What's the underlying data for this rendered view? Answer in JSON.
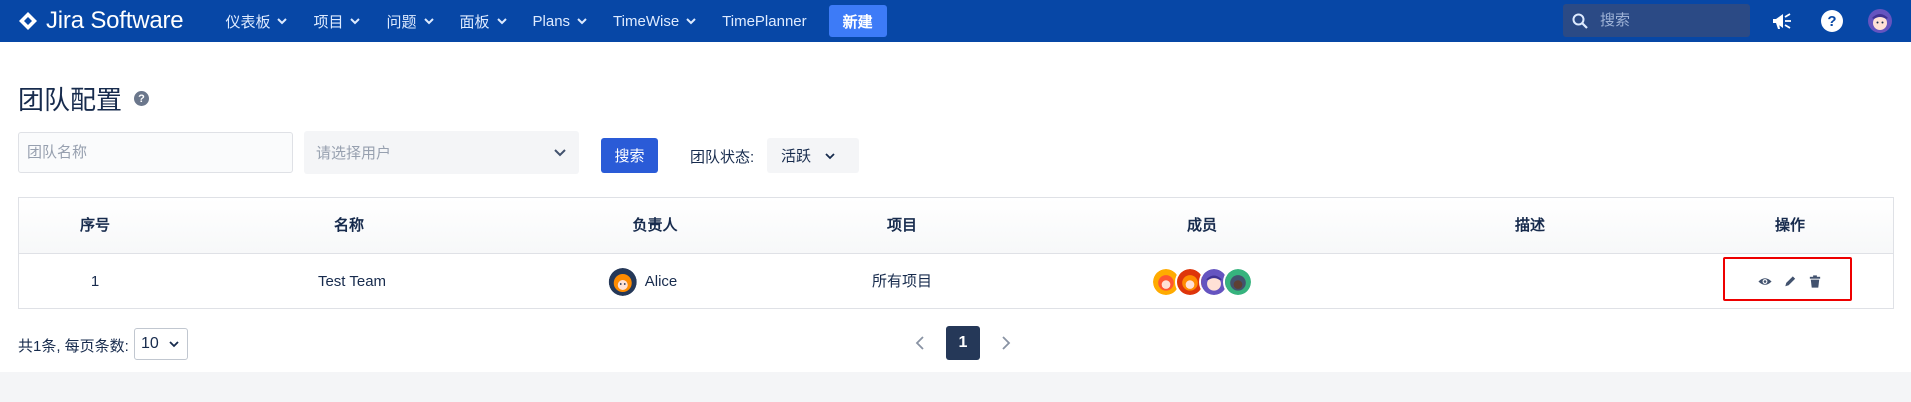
{
  "nav": {
    "logo_text": "Jira Software",
    "items": [
      {
        "label": "仪表板",
        "dropdown": true
      },
      {
        "label": "项目",
        "dropdown": true
      },
      {
        "label": "问题",
        "dropdown": true
      },
      {
        "label": "面板",
        "dropdown": true
      },
      {
        "label": "Plans",
        "dropdown": true
      },
      {
        "label": "TimeWise",
        "dropdown": true
      },
      {
        "label": "TimePlanner",
        "dropdown": false
      }
    ],
    "create_label": "新建",
    "search_placeholder": "搜索",
    "icons": [
      "megaphone-icon",
      "help-icon",
      "user-avatar"
    ],
    "bar_color": "#0747a6"
  },
  "page": {
    "title": "团队配置",
    "help_glyph": "?"
  },
  "filters": {
    "team_name_placeholder": "团队名称",
    "user_select_placeholder": "请选择用户",
    "search_button": "搜索",
    "status_label": "团队状态:",
    "status_value": "活跃"
  },
  "table": {
    "headers": [
      "序号",
      "名称",
      "负责人",
      "项目",
      "成员",
      "描述",
      "操作"
    ],
    "rows": [
      {
        "index": "1",
        "name": "Test Team",
        "owner": "Alice",
        "project": "所有项目",
        "members": [
          "orange",
          "red",
          "purple",
          "green"
        ],
        "description": "",
        "actions": [
          "view-icon",
          "edit-icon",
          "delete-icon"
        ]
      }
    ],
    "highlight_color": "#e00000"
  },
  "pagination": {
    "total_text": "共1条, 每页条数:",
    "page_size": "10",
    "current_page": "1"
  }
}
